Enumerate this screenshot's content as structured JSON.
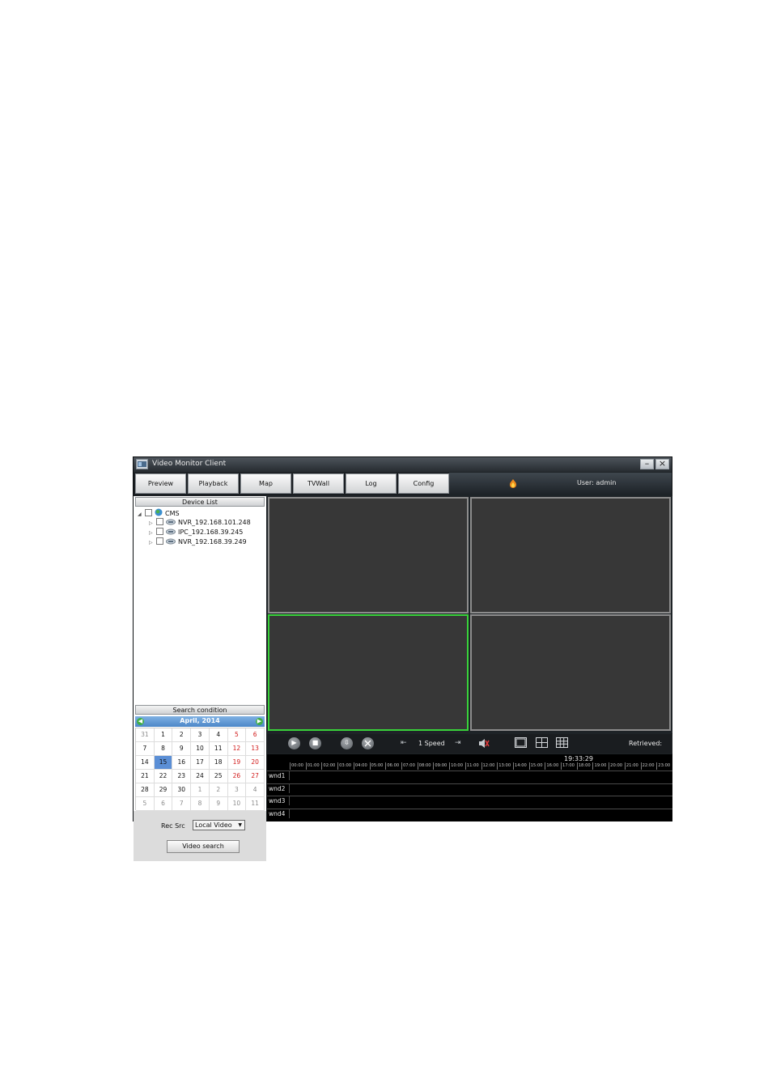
{
  "window": {
    "title": "Video Monitor Client",
    "minimize_glyph": "–",
    "close_glyph": "×"
  },
  "tabs": [
    {
      "label": "Preview"
    },
    {
      "label": "Playback"
    },
    {
      "label": "Map"
    },
    {
      "label": "TVWall"
    },
    {
      "label": "Log"
    },
    {
      "label": "Config"
    }
  ],
  "status": {
    "user": "User: admin"
  },
  "device_list": {
    "header": "Device List",
    "root": "CMS",
    "devices": [
      "NVR_192.168.101.248",
      "IPC_192.168.39.245",
      "NVR_192.168.39.249"
    ]
  },
  "search": {
    "header": "Search condition",
    "calendar_title": "April, 2014",
    "prev_glyph": "◀",
    "next_glyph": "▶",
    "selected_day": "15",
    "weeks": [
      [
        "31",
        "1",
        "2",
        "3",
        "4",
        "5",
        "6"
      ],
      [
        "7",
        "8",
        "9",
        "10",
        "11",
        "12",
        "13"
      ],
      [
        "14",
        "15",
        "16",
        "17",
        "18",
        "19",
        "20"
      ],
      [
        "21",
        "22",
        "23",
        "24",
        "25",
        "26",
        "27"
      ],
      [
        "28",
        "29",
        "30",
        "1",
        "2",
        "3",
        "4"
      ],
      [
        "5",
        "6",
        "7",
        "8",
        "9",
        "10",
        "11"
      ]
    ],
    "rec_src_label": "Rec Src",
    "rec_src_value": "Local Video",
    "video_search_label": "Video search"
  },
  "controls": {
    "speed": "1 Speed",
    "retrieved": "Retrieved:",
    "play_glyph": "▶",
    "stop_glyph": "■",
    "download_glyph": "⇩",
    "slow_glyph": "⇤",
    "fast_glyph": "⇥"
  },
  "timeline": {
    "current_time": "19:33:29",
    "hours": [
      "00:00",
      "01:00",
      "02:00",
      "03:00",
      "04:00",
      "05:00",
      "06:00",
      "07:00",
      "08:00",
      "09:00",
      "10:00",
      "11:00",
      "12:00",
      "13:00",
      "14:00",
      "15:00",
      "16:00",
      "17:00",
      "18:00",
      "19:00",
      "20:00",
      "21:00",
      "22:00",
      "23:00"
    ],
    "windows": [
      "wnd1",
      "wnd2",
      "wnd3",
      "wnd4"
    ]
  },
  "colors": {
    "active_window_border": "#39d23a",
    "calendar_header": "#4c87c8",
    "weekend_text": "#d11a1a",
    "selected_day_bg": "#5b8fd6"
  }
}
